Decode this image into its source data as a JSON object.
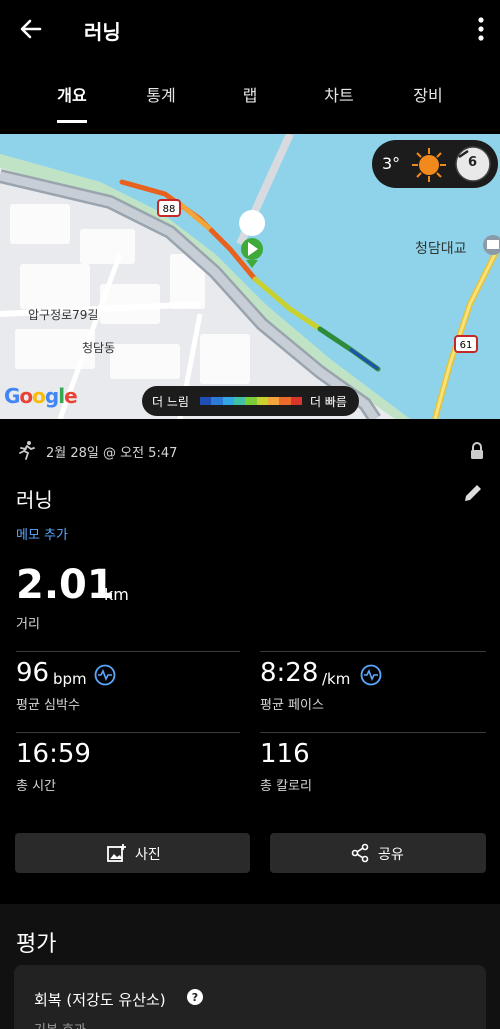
{
  "header": {
    "title": "러닝",
    "back_icon": "arrow-left-icon",
    "menu_icon": "more-vertical-icon"
  },
  "tabs": [
    {
      "label": "개요",
      "active": true
    },
    {
      "label": "통계",
      "active": false
    },
    {
      "label": "랩",
      "active": false
    },
    {
      "label": "차트",
      "active": false
    },
    {
      "label": "장비",
      "active": false
    }
  ],
  "map": {
    "weather": {
      "temperature": "3°",
      "wind": "6",
      "condition_icon": "sun-icon"
    },
    "labels": {
      "bridge": "청담대교",
      "street": "압구정로79길",
      "neighborhood": "청담동",
      "road_88": "88",
      "road_61": "61"
    },
    "pace_legend": {
      "slow": "더 느림",
      "fast": "더 빠름",
      "colors": [
        "#1f4fb5",
        "#2a7ad6",
        "#33a7e6",
        "#3fc1a5",
        "#7ccb3a",
        "#c8d12d",
        "#f2a53a",
        "#ec6a2c",
        "#d8362b"
      ]
    },
    "logo": "Google"
  },
  "activity": {
    "date": "2월 28일 @ 오전 5:47",
    "name": "러닝",
    "memo_link": "메모 추가",
    "distance": {
      "value": "2.01",
      "unit": "km",
      "label": "거리"
    }
  },
  "stats": {
    "heart_rate": {
      "value": "96",
      "unit": "bpm",
      "label": "평균 심박수"
    },
    "pace": {
      "value": "8:28",
      "unit": "/km",
      "label": "평균 페이스"
    },
    "time": {
      "value": "16:59",
      "label": "총 시간"
    },
    "calories": {
      "value": "116",
      "label": "총 칼로리"
    }
  },
  "actions": {
    "photo": "사진",
    "share": "공유"
  },
  "evaluation": {
    "title": "평가",
    "card_title": "회복 (저강도 유산소)",
    "card_subtitle": "기본 효과"
  },
  "colors": {
    "accent": "#5aa9ff",
    "background": "#000000",
    "card": "#222222",
    "button": "#2a2a2a"
  }
}
